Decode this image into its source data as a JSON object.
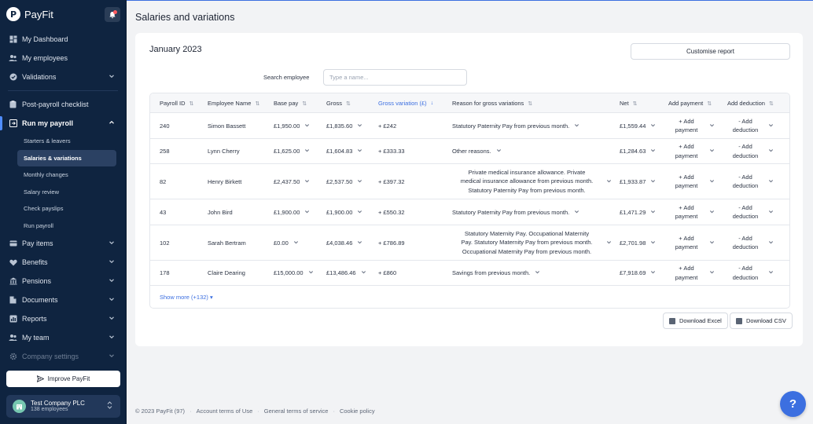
{
  "brand": {
    "name": "PayFit"
  },
  "sidebar": {
    "items": [
      {
        "label": "My Dashboard",
        "icon": "dashboard-icon"
      },
      {
        "label": "My employees",
        "icon": "people-icon"
      },
      {
        "label": "Validations",
        "icon": "check-circle-icon"
      },
      {
        "label": "Post-payroll checklist",
        "icon": "clipboard-icon"
      },
      {
        "label": "Run my payroll",
        "icon": "run-icon"
      },
      {
        "label": "Pay items",
        "icon": "card-icon"
      },
      {
        "label": "Benefits",
        "icon": "heart-icon"
      },
      {
        "label": "Pensions",
        "icon": "bank-icon"
      },
      {
        "label": "Documents",
        "icon": "document-icon"
      },
      {
        "label": "Reports",
        "icon": "chart-icon"
      },
      {
        "label": "My team",
        "icon": "team-icon"
      },
      {
        "label": "Company settings",
        "icon": "gear-icon"
      }
    ],
    "payroll_sub": [
      "Starters & leavers",
      "Salaries & variations",
      "Monthly changes",
      "Salary review",
      "Check payslips",
      "Run payroll"
    ],
    "improve_label": "Improve PayFit",
    "company": {
      "name": "Test Company PLC",
      "employees": "138 employees"
    }
  },
  "page": {
    "title": "Salaries and variations",
    "period": "January 2023",
    "customise_label": "Customise report",
    "search_label": "Search employee",
    "search_placeholder": "Type a name...",
    "show_more": "Show more (+132)",
    "download_excel": "Download Excel",
    "download_csv": "Download CSV"
  },
  "table": {
    "headers": [
      "Payroll ID",
      "Employee Name",
      "Base pay",
      "Gross",
      "Gross variation (£)",
      "Reason for gross variations",
      "Net",
      "Add payment",
      "Add deduction"
    ],
    "add_payment": [
      "+ Add",
      "payment"
    ],
    "add_deduction": [
      "- Add",
      "deduction"
    ],
    "rows": [
      {
        "id": "240",
        "name": "Simon Bassett",
        "base": "£1,950.00",
        "gross": "£1,835.60",
        "variation": "+ £242",
        "reason": [
          "Statutory Paternity Pay from previous month."
        ],
        "net": "£1,559.44"
      },
      {
        "id": "258",
        "name": "Lynn Cherry",
        "base": "£1,625.00",
        "gross": "£1,604.83",
        "variation": "+ £333.33",
        "reason": [
          "Other reasons."
        ],
        "net": "£1,284.63"
      },
      {
        "id": "82",
        "name": "Henry Birkett",
        "base": "£2,437.50",
        "gross": "£2,537.50",
        "variation": "+ £397.32",
        "reason": [
          "Private medical insurance allowance. Private",
          "medical insurance allowance from previous month.",
          "Statutory Paternity Pay from previous month."
        ],
        "net": "£1,933.87"
      },
      {
        "id": "43",
        "name": "John Bird",
        "base": "£1,900.00",
        "gross": "£1,900.00",
        "variation": "+ £550.32",
        "reason": [
          "Statutory Paternity Pay from previous month."
        ],
        "net": "£1,471.29"
      },
      {
        "id": "102",
        "name": "Sarah Bertram",
        "base": "£0.00",
        "gross": "£4,038.46",
        "variation": "+ £786.89",
        "reason": [
          "Statutory Maternity Pay. Occupational Maternity",
          "Pay. Statutory Maternity Pay from previous month.",
          "Occupational Maternity Pay from previous month."
        ],
        "net": "£2,701.98"
      },
      {
        "id": "178",
        "name": "Claire Dearing",
        "base": "£15,000.00",
        "gross": "£13,486.46",
        "variation": "+ £860",
        "reason": [
          "Savings from previous month."
        ],
        "net": "£7,918.69"
      }
    ]
  },
  "footer": {
    "copyright": "© 2023 PayFit (97)",
    "links": [
      "Account terms of Use",
      "General terms of service",
      "Cookie policy"
    ]
  },
  "colors": {
    "sidebar": "#0f2440",
    "accent": "#3c6fe0"
  }
}
